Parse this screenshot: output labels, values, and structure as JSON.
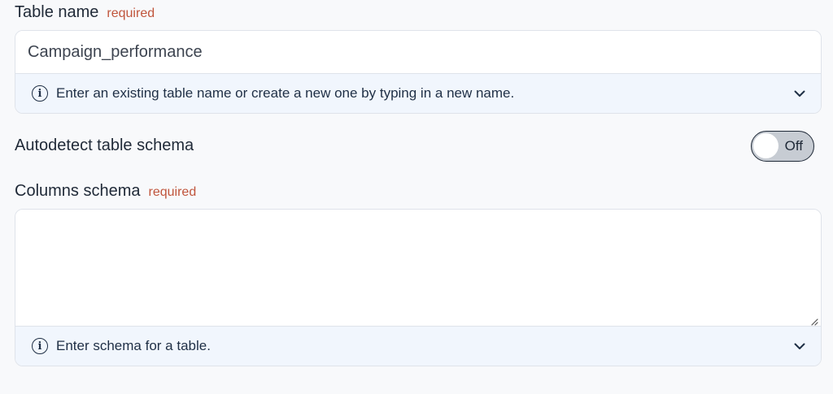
{
  "table_name": {
    "label": "Table name",
    "required": "required",
    "value": "Campaign_performance",
    "hint": "Enter an existing table name or create a new one by typing in a new name."
  },
  "autodetect": {
    "label": "Autodetect table schema",
    "state": "Off"
  },
  "columns_schema": {
    "label": "Columns schema",
    "required": "required",
    "value": "",
    "hint": "Enter schema for a table."
  },
  "icons": {
    "info": "info-icon",
    "expand": "chevron-down-icon",
    "resize": "resize-handle-icon"
  },
  "colors": {
    "required": "#c0553c",
    "hint_bg": "#f1f6fd",
    "toggle_off_bg": "#c7ccd3"
  }
}
